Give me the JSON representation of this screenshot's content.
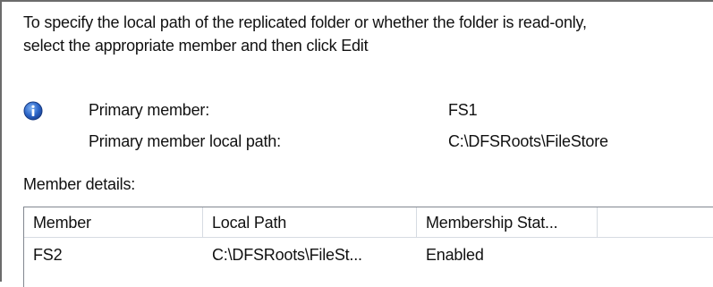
{
  "instructions": "To specify the local path of the replicated folder or whether the folder is read-only,\nselect the appropriate member and then click Edit",
  "info": {
    "icon": "info-icon",
    "primary_member_label": "Primary member:",
    "primary_member_value": "FS1",
    "primary_path_label": "Primary member local path:",
    "primary_path_value": "C:\\DFSRoots\\FileStore"
  },
  "member_details": {
    "label": "Member details:",
    "columns": [
      "Member",
      "Local Path",
      "Membership Stat...",
      ""
    ],
    "rows": [
      {
        "member": "FS2",
        "local_path": "C:\\DFSRoots\\FileSt...",
        "membership_status": "Enabled"
      }
    ]
  },
  "colors": {
    "info_blue": "#2a64c8",
    "border": "#828790",
    "header_divider": "#d6dbe2"
  }
}
